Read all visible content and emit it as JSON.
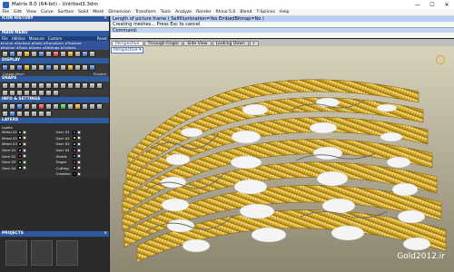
{
  "window": {
    "title": "Matrix 8.0 (64-bit) - Untitled3.3dm",
    "min": "—",
    "max": "☐",
    "close": "✕"
  },
  "menu": [
    "File",
    "Edit",
    "View",
    "Curve",
    "Surface",
    "Solid",
    "Mesh",
    "Dimension",
    "Transform",
    "Tools",
    "Analyze",
    "Render",
    "Rhino 5.0",
    "Blend",
    "T-Splines",
    "Help"
  ],
  "left_panel": {
    "history": {
      "title": "ICON HISTORY",
      "close": "✕"
    },
    "main_menu": {
      "title": "MAIN MENU",
      "tabs": [
        "File",
        "Utilities",
        "Measure",
        "Custom",
        "Reset"
      ],
      "rows": [
        [
          "▸Curve",
          "▸Surface",
          "▸Solid",
          "▸Transform",
          "▸Tbuilme"
        ],
        [
          "▸Builder",
          "▸Tools",
          "▸Gems",
          "▸Settings",
          "▸Cutters"
        ]
      ]
    },
    "display": {
      "title": "DISPLAY",
      "labels": [
        "Create Mesh",
        "Shaded"
      ]
    },
    "snaps": {
      "title": "SNAPS"
    },
    "info": {
      "title": "INFO & SETTINGS"
    },
    "layers": {
      "title": "LAYERS",
      "top_label": "Lights",
      "left": [
        {
          "name": "Metal 01",
          "color": "#c9a83a"
        },
        {
          "name": "Metal 02",
          "color": "#b5b5b5"
        },
        {
          "name": "Metal 03",
          "color": "#d98b3a"
        },
        {
          "name": "Gem 01",
          "color": "#6a9be0"
        },
        {
          "name": "Gem 02",
          "color": "#cc3a3a"
        },
        {
          "name": "Gem 03",
          "color": "#3ac23a"
        },
        {
          "name": "Gem 04",
          "color": "#d6d6d6"
        }
      ],
      "right": [
        {
          "name": "User 01",
          "color": "#3a6ad4"
        },
        {
          "name": "User 02",
          "color": "#d4d43a"
        },
        {
          "name": "User 03",
          "color": "#3ac2c2"
        },
        {
          "name": "User 04",
          "color": "#c23ac2"
        },
        {
          "name": "Heads",
          "color": "#777777"
        },
        {
          "name": "Finger",
          "color": "#cc3a3a"
        },
        {
          "name": "Cutting",
          "color": "#e08a2a"
        },
        {
          "name": "Creation",
          "color": "#3a3a3a"
        }
      ]
    },
    "projects": {
      "title": "PROJECTS",
      "close": "✕"
    }
  },
  "command": {
    "lines": [
      "Length of picture frame ( SelfIllumination=Yes  EmbedBitmap=No )",
      "Creating meshes... Press Esc to cancel"
    ],
    "prompt": "Command:"
  },
  "viewport_tabs": [
    "Perspective",
    "Through Finger",
    "Side View",
    "Looking Down",
    "+"
  ],
  "viewport": {
    "label": "Perspective ▾",
    "watermark": "Gold2012.ir"
  }
}
